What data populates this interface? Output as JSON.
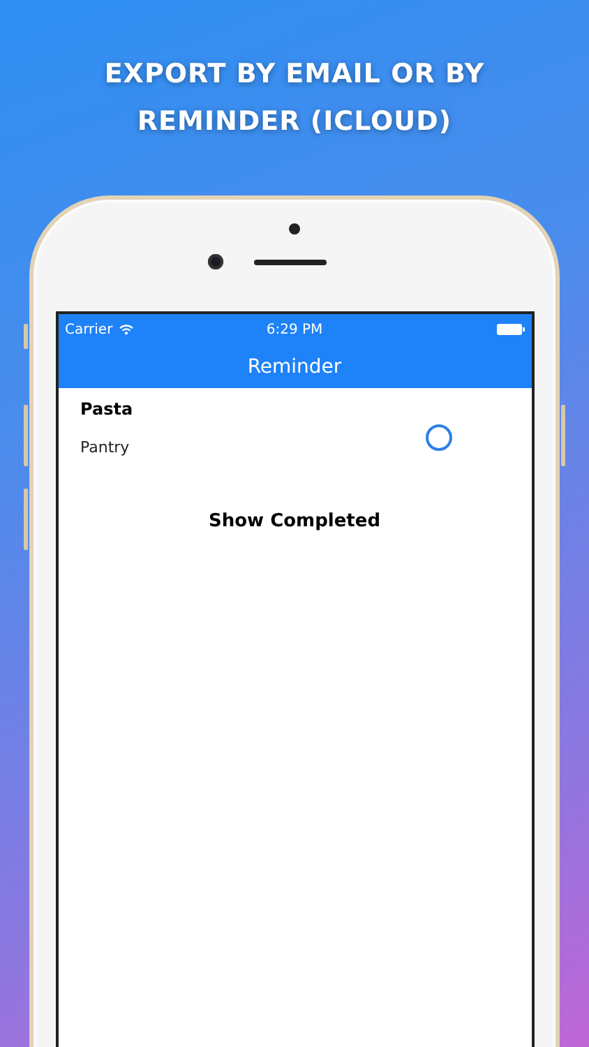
{
  "headline": "EXPORT BY EMAIL OR BY REMINDER (ICLOUD)",
  "status_bar": {
    "carrier": "Carrier",
    "time": "6:29 PM"
  },
  "nav_title": "Reminder",
  "reminders": [
    {
      "title": "Pasta",
      "list": "Pantry",
      "completed": false
    }
  ],
  "show_completed_button": "Show Completed"
}
